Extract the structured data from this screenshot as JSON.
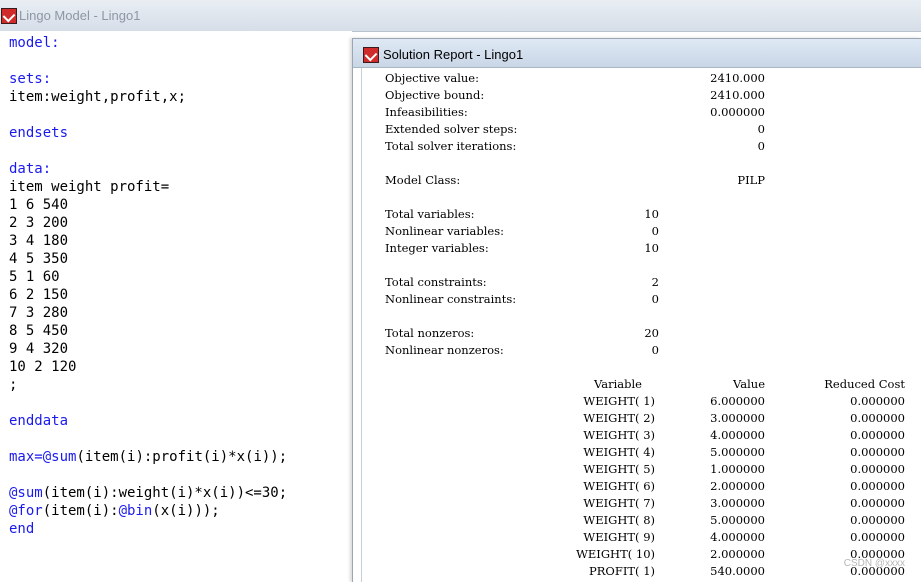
{
  "model_window": {
    "title": "Lingo Model - Lingo1",
    "code_lines": [
      [
        {
          "t": "model:",
          "k": true
        }
      ],
      [],
      [
        {
          "t": "sets:",
          "k": true
        }
      ],
      [
        {
          "t": "item:weight,profit,x;",
          "k": false
        }
      ],
      [],
      [
        {
          "t": "endsets",
          "k": true
        }
      ],
      [],
      [
        {
          "t": "data:",
          "k": true
        }
      ],
      [
        {
          "t": "item weight profit=",
          "k": false
        }
      ],
      [
        {
          "t": "1 6 540",
          "k": false
        }
      ],
      [
        {
          "t": "2 3 200",
          "k": false
        }
      ],
      [
        {
          "t": "3 4 180",
          "k": false
        }
      ],
      [
        {
          "t": "4 5 350",
          "k": false
        }
      ],
      [
        {
          "t": "5 1 60",
          "k": false
        }
      ],
      [
        {
          "t": "6 2 150",
          "k": false
        }
      ],
      [
        {
          "t": "7 3 280",
          "k": false
        }
      ],
      [
        {
          "t": "8 5 450",
          "k": false
        }
      ],
      [
        {
          "t": "9 4 320",
          "k": false
        }
      ],
      [
        {
          "t": "10 2 120",
          "k": false
        }
      ],
      [
        {
          "t": ";",
          "k": false
        }
      ],
      [],
      [
        {
          "t": "enddata",
          "k": true
        }
      ],
      [],
      [
        {
          "t": "max=",
          "k": true
        },
        {
          "t": "@sum",
          "k": true
        },
        {
          "t": "(item(i):profit(i)*x(i));",
          "k": false
        }
      ],
      [],
      [
        {
          "t": "@sum",
          "k": true
        },
        {
          "t": "(item(i):weight(i)*x(i))<=30;",
          "k": false
        }
      ],
      [
        {
          "t": "@for",
          "k": true
        },
        {
          "t": "(item(i):",
          "k": false
        },
        {
          "t": "@bin",
          "k": true
        },
        {
          "t": "(x(i)));",
          "k": false
        }
      ],
      [
        {
          "t": "end",
          "k": true
        }
      ]
    ]
  },
  "report_window": {
    "title": "Solution Report - Lingo1",
    "summary": [
      {
        "label": "Objective value:",
        "value": "2410.000",
        "col": "far"
      },
      {
        "label": "Objective bound:",
        "value": "2410.000",
        "col": "far"
      },
      {
        "label": "Infeasibilities:",
        "value": "0.000000",
        "col": "far"
      },
      {
        "label": "Extended solver steps:",
        "value": "0",
        "col": "far"
      },
      {
        "label": "Total solver iterations:",
        "value": "0",
        "col": "far"
      },
      {
        "label": "",
        "value": "",
        "col": "far"
      },
      {
        "label": "Model Class:",
        "value": "PILP",
        "col": "far"
      },
      {
        "label": "",
        "value": "",
        "col": "far"
      },
      {
        "label": "Total variables:",
        "value": "10",
        "col": "near"
      },
      {
        "label": "Nonlinear variables:",
        "value": "0",
        "col": "near"
      },
      {
        "label": "Integer variables:",
        "value": "10",
        "col": "near"
      },
      {
        "label": "",
        "value": "",
        "col": "near"
      },
      {
        "label": "Total constraints:",
        "value": "2",
        "col": "near"
      },
      {
        "label": "Nonlinear constraints:",
        "value": "0",
        "col": "near"
      },
      {
        "label": "",
        "value": "",
        "col": "near"
      },
      {
        "label": "Total nonzeros:",
        "value": "20",
        "col": "near"
      },
      {
        "label": "Nonlinear nonzeros:",
        "value": "0",
        "col": "near"
      }
    ],
    "table": {
      "headers": {
        "variable": "Variable",
        "value": "Value",
        "reduced_cost": "Reduced Cost"
      },
      "rows": [
        {
          "variable": "WEIGHT( 1)",
          "value": "6.000000",
          "reduced_cost": "0.000000"
        },
        {
          "variable": "WEIGHT( 2)",
          "value": "3.000000",
          "reduced_cost": "0.000000"
        },
        {
          "variable": "WEIGHT( 3)",
          "value": "4.000000",
          "reduced_cost": "0.000000"
        },
        {
          "variable": "WEIGHT( 4)",
          "value": "5.000000",
          "reduced_cost": "0.000000"
        },
        {
          "variable": "WEIGHT( 5)",
          "value": "1.000000",
          "reduced_cost": "0.000000"
        },
        {
          "variable": "WEIGHT( 6)",
          "value": "2.000000",
          "reduced_cost": "0.000000"
        },
        {
          "variable": "WEIGHT( 7)",
          "value": "3.000000",
          "reduced_cost": "0.000000"
        },
        {
          "variable": "WEIGHT( 8)",
          "value": "5.000000",
          "reduced_cost": "0.000000"
        },
        {
          "variable": "WEIGHT( 9)",
          "value": "4.000000",
          "reduced_cost": "0.000000"
        },
        {
          "variable": "WEIGHT( 10)",
          "value": "2.000000",
          "reduced_cost": "0.000000"
        },
        {
          "variable": "PROFIT( 1)",
          "value": "540.0000",
          "reduced_cost": "0.000000"
        }
      ]
    }
  },
  "watermark": "CSDN @xxxx",
  "colors": {
    "keyword": "#1a1af0",
    "title_inactive": "#8d97a4"
  },
  "icons": {
    "app": "lingo-app-icon"
  }
}
